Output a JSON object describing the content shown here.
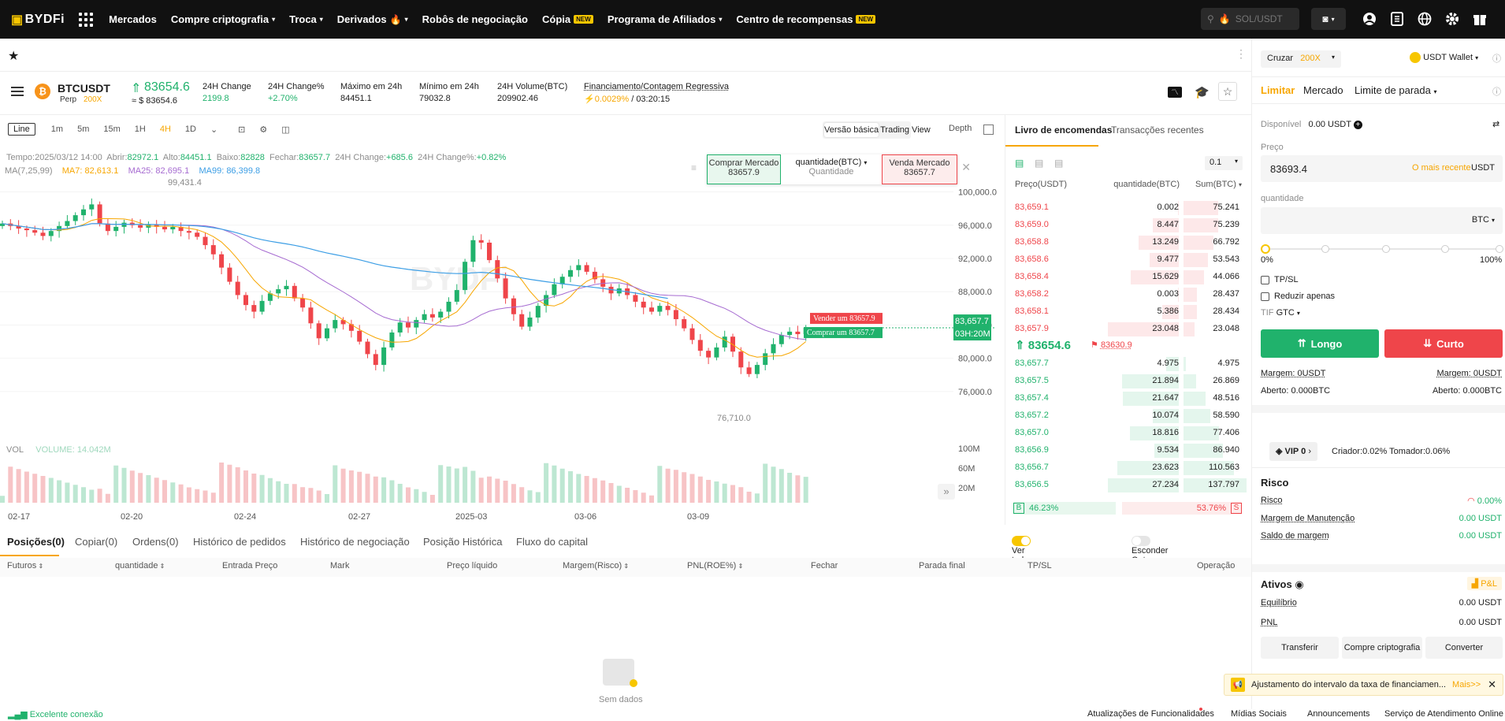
{
  "nav": {
    "logo": "BYDFi",
    "items": [
      {
        "label": "Mercados",
        "caret": false,
        "badge": ""
      },
      {
        "label": "Compre criptografia",
        "caret": true,
        "badge": ""
      },
      {
        "label": "Troca",
        "caret": true,
        "badge": ""
      },
      {
        "label": "Derivados",
        "caret": true,
        "badge": "",
        "fire": true
      },
      {
        "label": "Robôs de negociação",
        "caret": false,
        "badge": ""
      },
      {
        "label": "Cópia",
        "caret": false,
        "badge": "NEW"
      },
      {
        "label": "Programa de Afiliados",
        "caret": true,
        "badge": ""
      },
      {
        "label": "Centro de recompensas",
        "caret": false,
        "badge": "NEW"
      }
    ],
    "search_placeholder": "SOL/USDT"
  },
  "ticker": {
    "symbol": "BTCUSDT",
    "type": "Perp",
    "leverage": "200X",
    "last_price": "83654.6",
    "last_price_usd": "≈ $ 83654.6",
    "change_label": "24H Change",
    "change_value": "2199.8",
    "change_pct_label": "24H Change%",
    "change_pct_value": "+2.70%",
    "high_label": "Máximo em 24h",
    "high_value": "84451.1",
    "low_label": "Mínimo em 24h",
    "low_value": "79032.8",
    "vol_label": "24H Volume(BTC)",
    "vol_value": "209902.46",
    "funding_label": "Financiamento/Contagem Regressiva",
    "funding_rate": "0.0029%",
    "funding_countdown": "/ 03:20:15"
  },
  "chart_tools": {
    "line": "Line",
    "timeframes": [
      "1m",
      "5m",
      "15m",
      "1H",
      "4H",
      "1D"
    ],
    "active_tf": "4H",
    "basic": "Versão básica",
    "tradingview": "Trading View",
    "depth": "Depth"
  },
  "chart_info": {
    "time": "Tempo:2025/03/12 14:00",
    "open_label": "Abrir:",
    "open": "82972.1",
    "high_label": "Alto:",
    "high": "84451.1",
    "low_label": "Baixo:",
    "low": "82828",
    "close_label": "Fechar:",
    "close": "83657.7",
    "chg_label": "24H Change:",
    "chg": "+685.6",
    "chgp_label": "24H Change%:",
    "chgp": "+0.82%",
    "ma_main": "MA(7,25,99)",
    "ma7": "MA7: 82,613.1",
    "ma25": "MA25: 82,695.1",
    "ma99": "MA99: 86,399.8",
    "vol_label": "VOL",
    "vol_value": "VOLUME: 14.042M",
    "max_marker": "99,431.4",
    "min_marker": "76,710.0",
    "sell_tag": "Vender um 83657.9",
    "buy_tag": "Comprar um 83657.7",
    "price_tag": "83,657.7",
    "countdown_tag": "03H:20M",
    "watermark": "BYDFi"
  },
  "quick_order": {
    "buy_label": "Comprar Mercado",
    "buy_price": "83657.9",
    "qty_label": "quantidade(BTC)",
    "qty_placeholder": "Quantidade",
    "sell_label": "Venda Mercado",
    "sell_price": "83657.7"
  },
  "chart_data": {
    "type": "candlestick",
    "price_axis": [
      "100,000.0",
      "96,000.0",
      "92,000.0",
      "88,000.0",
      "84,000.0",
      "80,000.0",
      "76,000.0"
    ],
    "volume_axis": [
      "100M",
      "60M",
      "20M"
    ],
    "x_labels": [
      "02-17",
      "02-20",
      "02-24",
      "02-27",
      "2025-03",
      "03-06",
      "03-09"
    ],
    "ylim": [
      74000,
      101000
    ],
    "close": [
      96200,
      95900,
      95600,
      95400,
      95100,
      94700,
      95300,
      95900,
      96500,
      97200,
      97900,
      98500,
      96200,
      95300,
      95800,
      96300,
      96000,
      95700,
      96100,
      95800,
      95500,
      95800,
      95300,
      95100,
      94600,
      93600,
      92500,
      90900,
      89200,
      87600,
      86400,
      85600,
      86900,
      87800,
      88300,
      88700,
      87200,
      86100,
      84200,
      82400,
      83600,
      84600,
      84100,
      83300,
      82000,
      80500,
      79200,
      81300,
      83100,
      84300,
      83700,
      84600,
      85300,
      84900,
      85600,
      86800,
      88200,
      91600,
      94200,
      93900,
      91800,
      89600,
      87200,
      85300,
      83800,
      84900,
      86300,
      87600,
      88900,
      89800,
      90600,
      91200,
      90400,
      89500,
      88600,
      87800,
      88400,
      87600,
      86800,
      86100,
      85600,
      86300,
      85800,
      84700,
      83600,
      82200,
      80900,
      80100,
      81300,
      82600,
      80800,
      78900,
      78100,
      79200,
      80600,
      81700,
      82800,
      83200,
      82900,
      83657.7
    ]
  },
  "orderbook": {
    "tab_book": "Livro de encomendas",
    "tab_trades": "Transacções recentes",
    "precision": "0.1",
    "col_price": "Preço(USDT)",
    "col_qty": "quantidade(BTC)",
    "col_sum": "Sum(BTC)",
    "asks": [
      {
        "p": "83,659.1",
        "q": "0.002",
        "s": "75.241"
      },
      {
        "p": "83,659.0",
        "q": "8.447",
        "s": "75.239"
      },
      {
        "p": "83,658.8",
        "q": "13.249",
        "s": "66.792"
      },
      {
        "p": "83,658.6",
        "q": "9.477",
        "s": "53.543"
      },
      {
        "p": "83,658.4",
        "q": "15.629",
        "s": "44.066"
      },
      {
        "p": "83,658.2",
        "q": "0.003",
        "s": "28.437"
      },
      {
        "p": "83,658.1",
        "q": "5.386",
        "s": "28.434"
      },
      {
        "p": "83,657.9",
        "q": "23.048",
        "s": "23.048"
      }
    ],
    "ask_qty_frac": [
      0.01,
      0.37,
      0.57,
      0.41,
      0.68,
      0.01,
      0.23,
      1.0
    ],
    "ask_sum_frac": [
      0.55,
      0.55,
      0.48,
      0.39,
      0.32,
      0.21,
      0.21,
      0.17
    ],
    "mid_price": "83654.6",
    "mark_price": "83630.9",
    "bids": [
      {
        "p": "83,657.7",
        "q": "4.975",
        "s": "4.975"
      },
      {
        "p": "83,657.5",
        "q": "21.894",
        "s": "26.869"
      },
      {
        "p": "83,657.4",
        "q": "21.647",
        "s": "48.516"
      },
      {
        "p": "83,657.2",
        "q": "10.074",
        "s": "58.590"
      },
      {
        "p": "83,657.0",
        "q": "18.816",
        "s": "77.406"
      },
      {
        "p": "83,656.9",
        "q": "9.534",
        "s": "86.940"
      },
      {
        "p": "83,656.7",
        "q": "23.623",
        "s": "110.563"
      },
      {
        "p": "83,656.5",
        "q": "27.234",
        "s": "137.797"
      }
    ],
    "bid_qty_frac": [
      0.18,
      0.8,
      0.79,
      0.37,
      0.69,
      0.35,
      0.87,
      1.0
    ],
    "bid_sum_frac": [
      0.04,
      0.2,
      0.35,
      0.43,
      0.56,
      0.63,
      0.8,
      1.0
    ],
    "buy_ratio_label": "B",
    "buy_ratio": "46.23%",
    "sell_ratio": "53.76%",
    "sell_ratio_label": "S",
    "buy_ratio_frac": 0.4623
  },
  "bottom": {
    "tabs": [
      "Posições(0)",
      "Copiar(0)",
      "Ordens(0)",
      "Histórico de pedidos",
      "Histórico de negociação",
      "Posição Histórica",
      "Fluxo do capital"
    ],
    "show_all": "Ver todas as posições",
    "hide_others": "Esconder Outros Pares",
    "columns": [
      "Futuros",
      "quantidade",
      "Entrada Preço",
      "Mark",
      "Preço líquido",
      "Margem(Risco)",
      "PNL(ROE%)",
      "Fechar",
      "Parada final",
      "TP/SL",
      "Operação"
    ],
    "empty": "Sem dados"
  },
  "right": {
    "margin_mode": "Cruzar",
    "leverage": "200X",
    "wallet": "USDT Wallet",
    "tabs": [
      "Limitar",
      "Mercado",
      "Limite de parada"
    ],
    "available_label": "Disponível",
    "available_value": "0.00 USDT",
    "price_label": "Preço",
    "price_value": "83693.4",
    "latest": "O mais recente",
    "price_unit": "USDT",
    "qty_label": "quantidade",
    "qty_unit": "BTC",
    "slider_min": "0%",
    "slider_max": "100%",
    "tpsl": "TP/SL",
    "reduce_only": "Reduzir apenas",
    "tif_label": "TIF",
    "tif_value": "GTC",
    "long": "Longo",
    "short": "Curto",
    "margin_left": "Margem: 0USDT",
    "margin_right": "Margem: 0USDT",
    "open_left": "Aberto: 0.000BTC",
    "open_right": "Aberto: 0.000BTC",
    "vip": "VIP 0",
    "fees": "Criador:0.02% Tomador:0.06%",
    "risk_title": "Risco",
    "risk_label": "Risco",
    "risk_value": "0.00%",
    "maint_label": "Margem de Manutenção",
    "maint_value": "0.00 USDT",
    "margin_bal_label": "Saldo de margem",
    "margin_bal_value": "0.00 USDT",
    "assets_title": "Ativos",
    "pnl_btn": "P&L",
    "equity_label": "Equilíbrio",
    "equity_value": "0.00 USDT",
    "pnl_label": "PNL",
    "pnl_value": "0.00 USDT",
    "transfer": "Transferir",
    "buy_crypto": "Compre criptografia",
    "convert": "Converter"
  },
  "notice": {
    "text": "Ajustamento do intervalo da taxa de financiamen...",
    "more": "Mais>>"
  },
  "footer": {
    "connection": "Excelente conexão",
    "links": [
      "Atualizações de Funcionalidades",
      "Mídias Sociais",
      "Announcements",
      "Serviço de Atendimento Online"
    ]
  },
  "colors": {
    "green": "#20b26c",
    "red": "#ef454a",
    "accent": "#f7a600",
    "ma7": "#f7a600",
    "ma25": "#a66bd1",
    "ma99": "#3c9ee5"
  }
}
